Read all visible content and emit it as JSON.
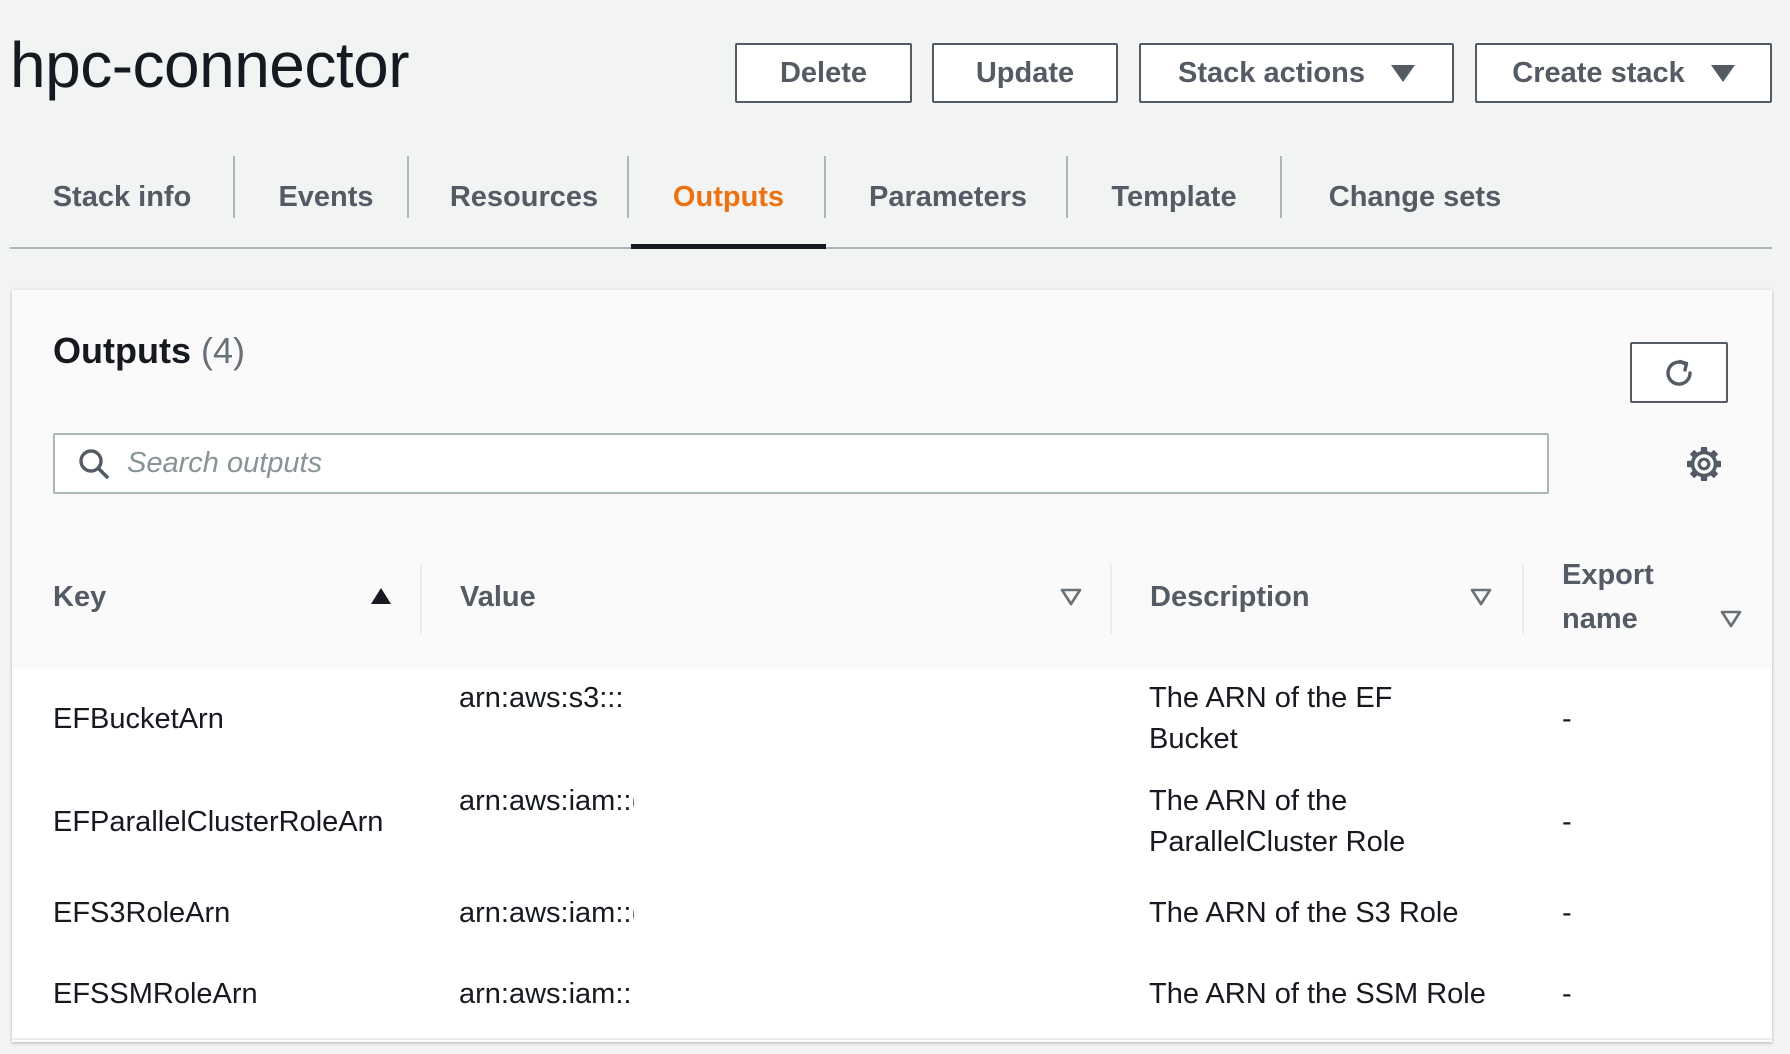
{
  "page": {
    "title": "hpc-connector"
  },
  "header_actions": {
    "delete_label": "Delete",
    "update_label": "Update",
    "stack_actions_label": "Stack actions",
    "create_stack_label": "Create stack"
  },
  "tabs": [
    {
      "label": "Stack info",
      "active": false
    },
    {
      "label": "Events",
      "active": false
    },
    {
      "label": "Resources",
      "active": false
    },
    {
      "label": "Outputs",
      "active": true
    },
    {
      "label": "Parameters",
      "active": false
    },
    {
      "label": "Template",
      "active": false
    },
    {
      "label": "Change sets",
      "active": false
    }
  ],
  "outputs_panel": {
    "title": "Outputs",
    "count": "(4)",
    "search_placeholder": "Search outputs",
    "search_value": ""
  },
  "table": {
    "columns": [
      {
        "label": "Key",
        "sort": "ascending"
      },
      {
        "label": "Value",
        "sort": "none"
      },
      {
        "label": "Description",
        "sort": "none"
      },
      {
        "label": "Export name",
        "sort": "none"
      }
    ],
    "rows": [
      {
        "key": "EFBucketArn",
        "value": "arn:aws:s3:::",
        "description": "The ARN of the EF Bucket",
        "export_name": "-"
      },
      {
        "key": "EFParallelClusterRoleArn",
        "value": "arn:aws:iam::(",
        "description": "The ARN of the ParallelCluster Role",
        "export_name": "-"
      },
      {
        "key": "EFS3RoleArn",
        "value": "arn:aws:iam::(",
        "description": "The ARN of the S3 Role",
        "export_name": "-"
      },
      {
        "key": "EFSSMRoleArn",
        "value": "arn:aws:iam::",
        "description": "The ARN of the SSM Role",
        "export_name": "-"
      }
    ]
  },
  "colors": {
    "accent": "#ec7211",
    "text": "#16191f",
    "muted": "#545b64",
    "border": "#aab7b8",
    "background": "#f2f3f3"
  },
  "icons": {
    "search": "search-icon",
    "refresh": "refresh-icon",
    "settings": "gear-icon",
    "sort_ascending": "caret-up-icon",
    "sort_none": "caret-down-outline-icon",
    "dropdown": "caret-down-icon"
  }
}
